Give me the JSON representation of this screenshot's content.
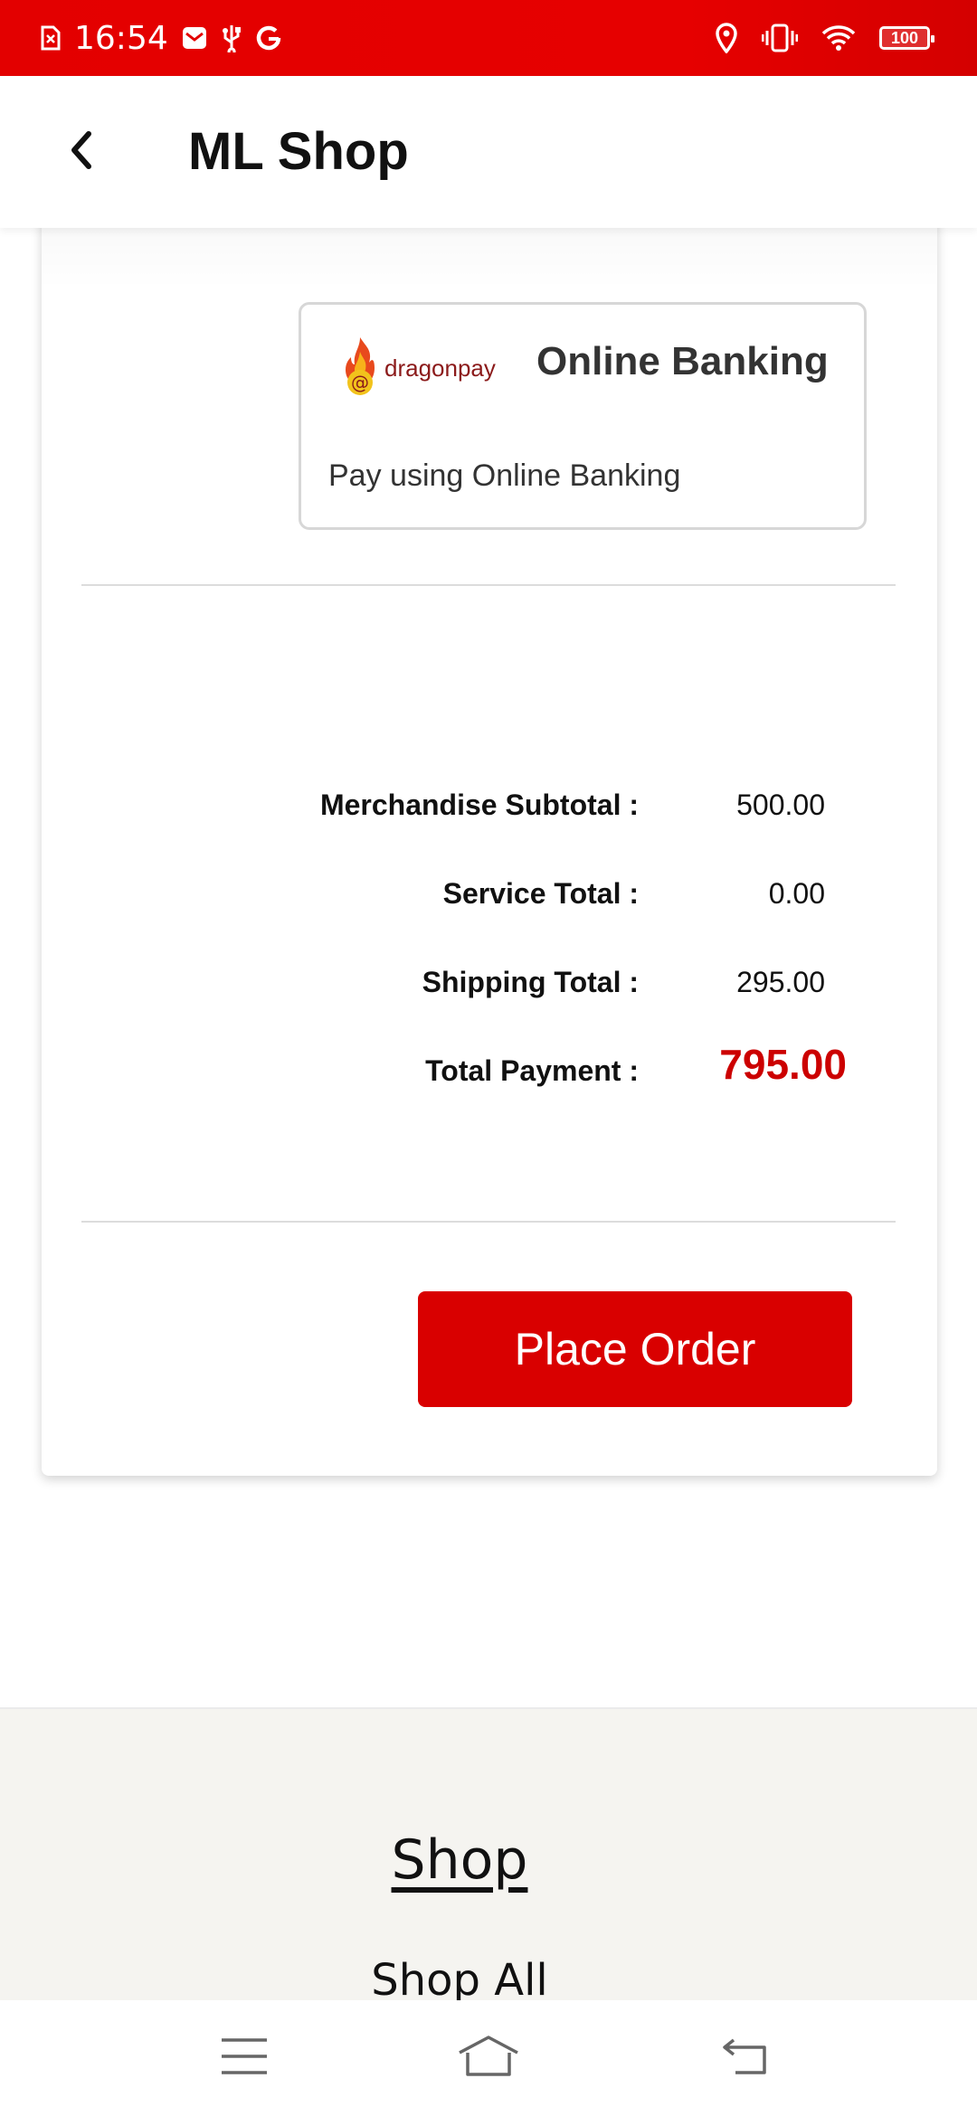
{
  "status_bar": {
    "time": "16:54",
    "left_icons": [
      "sim-error-icon",
      "mail-icon",
      "usb-icon",
      "google-icon"
    ],
    "right_icons": [
      "location-icon",
      "vibrate-icon",
      "wifi-icon"
    ],
    "battery": "100",
    "background": "#e30000"
  },
  "app_bar": {
    "title": "ML Shop",
    "back_icon": "chevron-left-icon"
  },
  "payment_option": {
    "provider_logo_text": "dragonpay",
    "title": "Online Banking",
    "description": "Pay using Online Banking"
  },
  "summary": {
    "rows": [
      {
        "label": "Merchandise Subtotal :",
        "value": "500.00"
      },
      {
        "label": "Service Total :",
        "value": "0.00"
      },
      {
        "label": "Shipping Total :",
        "value": "295.00"
      }
    ],
    "total_label": "Total Payment :",
    "total_value": "795.00",
    "total_color": "#cc0000"
  },
  "place_order": {
    "label": "Place Order",
    "color": "#d90000"
  },
  "footer": {
    "heading": "Shop",
    "links": [
      "Shop All"
    ]
  },
  "nav_bar": {
    "icons": [
      "menu-icon",
      "home-icon",
      "back-icon"
    ]
  }
}
